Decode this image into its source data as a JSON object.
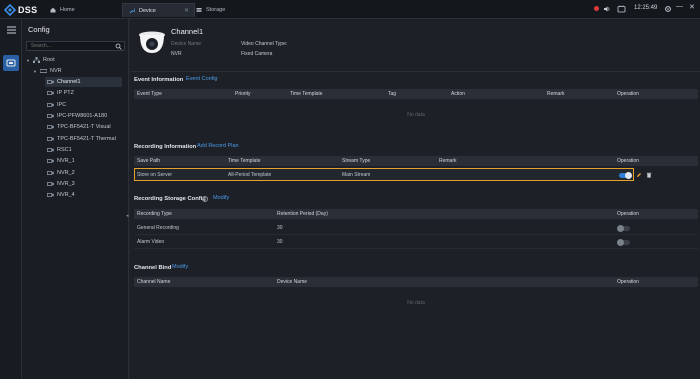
{
  "app": {
    "name": "DSS"
  },
  "tabs": [
    {
      "label": "Home",
      "icon": "home-icon",
      "active": false
    },
    {
      "label": "Device",
      "icon": "wrench-icon",
      "active": true
    },
    {
      "label": "Storage",
      "icon": "storage-icon",
      "active": false
    }
  ],
  "system": {
    "time": "12:25:49",
    "record_color": "#e03b3b"
  },
  "sidebar": {
    "title": "Config",
    "search_placeholder": "Search...",
    "tree": [
      {
        "label": "Root",
        "level": 0,
        "icon": "org-icon",
        "expanded": true
      },
      {
        "label": "NVR",
        "level": 1,
        "icon": "nvr-icon",
        "expanded": true
      },
      {
        "label": "Channel1",
        "level": 2,
        "icon": "camera-icon",
        "selected": true
      },
      {
        "label": "IP PTZ",
        "level": 2,
        "icon": "camera-icon"
      },
      {
        "label": "IPC",
        "level": 2,
        "icon": "camera-icon"
      },
      {
        "label": "IPC-PFW8601-A180",
        "level": 2,
        "icon": "camera-icon"
      },
      {
        "label": "TPC-BF5421-T Visual",
        "level": 2,
        "icon": "camera-icon"
      },
      {
        "label": "TPC-BF5421-T Thermal",
        "level": 2,
        "icon": "camera-icon"
      },
      {
        "label": "RSC1",
        "level": 2,
        "icon": "camera-icon"
      },
      {
        "label": "NVR_1",
        "level": 2,
        "icon": "camera-icon"
      },
      {
        "label": "NVR_2",
        "level": 2,
        "icon": "camera-icon"
      },
      {
        "label": "NVR_3",
        "level": 2,
        "icon": "camera-icon"
      },
      {
        "label": "NVR_4",
        "level": 2,
        "icon": "camera-icon"
      }
    ]
  },
  "channel": {
    "title": "Channel1",
    "device_name_label": "Device Name",
    "device_name_value": "NVR",
    "video_type_label": "Video Channel Type:",
    "video_type_value": "Fixed Camera"
  },
  "event_info": {
    "title": "Event Information",
    "link": "Event Config",
    "columns": [
      "Event Type",
      "Priority",
      "Time Template",
      "Tag",
      "Action",
      "Remark",
      "Operation"
    ],
    "empty_text": "No data"
  },
  "recording_info": {
    "title": "Recording Information",
    "link": "Add Record Plan",
    "columns": [
      "Save Path",
      "Time Template",
      "Stream Type",
      "Remark",
      "Operation"
    ],
    "rows": [
      {
        "save_path": "Store on Server",
        "time_template": "All-Period Template",
        "stream_type": "Main Stream",
        "remark": "",
        "enabled": true
      }
    ]
  },
  "storage_config": {
    "title": "Recording Storage Config",
    "link": "Modify",
    "columns": [
      "Recording Type",
      "Retention Period (Day)",
      "Operation"
    ],
    "rows": [
      {
        "type": "General Recording",
        "days": "30",
        "enabled": false
      },
      {
        "type": "Alarm Video",
        "days": "30",
        "enabled": false
      }
    ]
  },
  "channel_bind": {
    "title": "Channel Bind",
    "link": "Modify",
    "columns": [
      "Channel Name",
      "Device Name",
      "Operation"
    ],
    "empty_text": "No data"
  },
  "colors": {
    "accent": "#4a9be8",
    "highlight": "#e6a12a",
    "toggle_on": "#2f7ed8"
  }
}
